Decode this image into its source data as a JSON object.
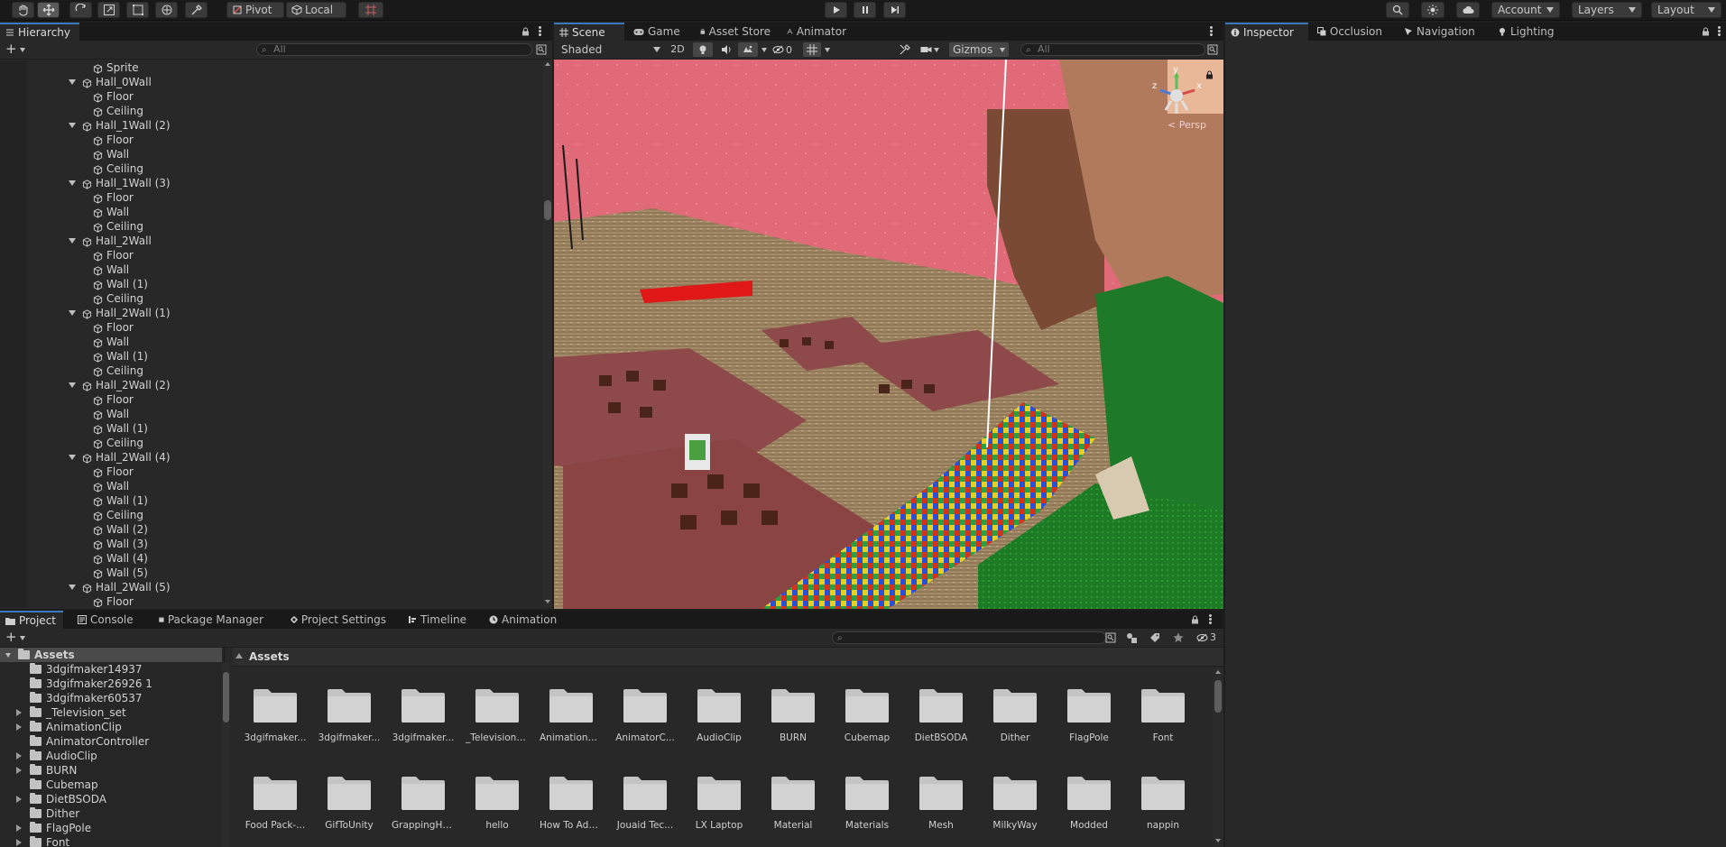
{
  "toolbar": {
    "pivot_label": "Pivot",
    "local_label": "Local",
    "account_label": "Account",
    "layers_label": "Layers",
    "layout_label": "Layout"
  },
  "hierarchy": {
    "tab_label": "Hierarchy",
    "search_placeholder": "All",
    "rows": [
      {
        "label": "Sprite",
        "depth": 3,
        "parent": false
      },
      {
        "label": "Hall_0Wall",
        "depth": 2,
        "parent": true
      },
      {
        "label": "Floor",
        "depth": 3,
        "parent": false
      },
      {
        "label": "Ceiling",
        "depth": 3,
        "parent": false
      },
      {
        "label": "Hall_1Wall (2)",
        "depth": 2,
        "parent": true
      },
      {
        "label": "Floor",
        "depth": 3,
        "parent": false
      },
      {
        "label": "Wall",
        "depth": 3,
        "parent": false
      },
      {
        "label": "Ceiling",
        "depth": 3,
        "parent": false
      },
      {
        "label": "Hall_1Wall (3)",
        "depth": 2,
        "parent": true
      },
      {
        "label": "Floor",
        "depth": 3,
        "parent": false
      },
      {
        "label": "Wall",
        "depth": 3,
        "parent": false
      },
      {
        "label": "Ceiling",
        "depth": 3,
        "parent": false
      },
      {
        "label": "Hall_2Wall",
        "depth": 2,
        "parent": true
      },
      {
        "label": "Floor",
        "depth": 3,
        "parent": false
      },
      {
        "label": "Wall",
        "depth": 3,
        "parent": false
      },
      {
        "label": "Wall (1)",
        "depth": 3,
        "parent": false
      },
      {
        "label": "Ceiling",
        "depth": 3,
        "parent": false
      },
      {
        "label": "Hall_2Wall (1)",
        "depth": 2,
        "parent": true
      },
      {
        "label": "Floor",
        "depth": 3,
        "parent": false
      },
      {
        "label": "Wall",
        "depth": 3,
        "parent": false
      },
      {
        "label": "Wall (1)",
        "depth": 3,
        "parent": false
      },
      {
        "label": "Ceiling",
        "depth": 3,
        "parent": false
      },
      {
        "label": "Hall_2Wall (2)",
        "depth": 2,
        "parent": true
      },
      {
        "label": "Floor",
        "depth": 3,
        "parent": false
      },
      {
        "label": "Wall",
        "depth": 3,
        "parent": false
      },
      {
        "label": "Wall (1)",
        "depth": 3,
        "parent": false
      },
      {
        "label": "Ceiling",
        "depth": 3,
        "parent": false
      },
      {
        "label": "Hall_2Wall (4)",
        "depth": 2,
        "parent": true
      },
      {
        "label": "Floor",
        "depth": 3,
        "parent": false
      },
      {
        "label": "Wall",
        "depth": 3,
        "parent": false
      },
      {
        "label": "Wall (1)",
        "depth": 3,
        "parent": false
      },
      {
        "label": "Ceiling",
        "depth": 3,
        "parent": false
      },
      {
        "label": "Wall (2)",
        "depth": 3,
        "parent": false
      },
      {
        "label": "Wall (3)",
        "depth": 3,
        "parent": false
      },
      {
        "label": "Wall (4)",
        "depth": 3,
        "parent": false
      },
      {
        "label": "Wall (5)",
        "depth": 3,
        "parent": false
      },
      {
        "label": "Hall_2Wall (5)",
        "depth": 2,
        "parent": true
      },
      {
        "label": "Floor",
        "depth": 3,
        "parent": false
      }
    ]
  },
  "scene": {
    "tabs": [
      "Scene",
      "Game",
      "Asset Store",
      "Animator"
    ],
    "shading_mode": "Shaded",
    "mode_2d": "2D",
    "hidden_count": "0",
    "gizmos_label": "Gizmos",
    "search_placeholder": "All",
    "persp_label": "< Persp",
    "axis_y": "y",
    "axis_z": "z",
    "axis_x": "x"
  },
  "inspector": {
    "tabs": [
      "Inspector",
      "Occlusion",
      "Navigation",
      "Lighting"
    ]
  },
  "project": {
    "tabs": [
      "Project",
      "Console",
      "Package Manager",
      "Project Settings",
      "Timeline",
      "Animation"
    ],
    "hidden_count": "3",
    "tree_root": "Assets",
    "tree_items": [
      {
        "label": "3dgifmaker14937",
        "expandable": false
      },
      {
        "label": "3dgifmaker26926 1",
        "expandable": false
      },
      {
        "label": "3dgifmaker60537",
        "expandable": false
      },
      {
        "label": "_Television_set",
        "expandable": true
      },
      {
        "label": "AnimationClip",
        "expandable": true
      },
      {
        "label": "AnimatorController",
        "expandable": false
      },
      {
        "label": "AudioClip",
        "expandable": true
      },
      {
        "label": "BURN",
        "expandable": true
      },
      {
        "label": "Cubemap",
        "expandable": false
      },
      {
        "label": "DietBSODA",
        "expandable": true
      },
      {
        "label": "Dither",
        "expandable": false
      },
      {
        "label": "FlagPole",
        "expandable": true
      },
      {
        "label": "Font",
        "expandable": true
      }
    ],
    "breadcrumb": "Assets",
    "grid_row1": [
      "3dgifmaker...",
      "3dgifmaker...",
      "3dgifmaker...",
      "_Television_...",
      "AnimationCl...",
      "AnimatorC...",
      "AudioClip",
      "BURN",
      "Cubemap",
      "DietBSODA",
      "Dither",
      "FlagPole",
      "Font"
    ],
    "grid_row2": [
      "Food Pack-...",
      "GifToUnity",
      "GrappingHo...",
      "hello",
      "How To Add...",
      "Jouaid Tec...",
      "LX Laptop",
      "Material",
      "Materials",
      "Mesh",
      "MilkyWay",
      "Modded",
      "nappin"
    ]
  }
}
